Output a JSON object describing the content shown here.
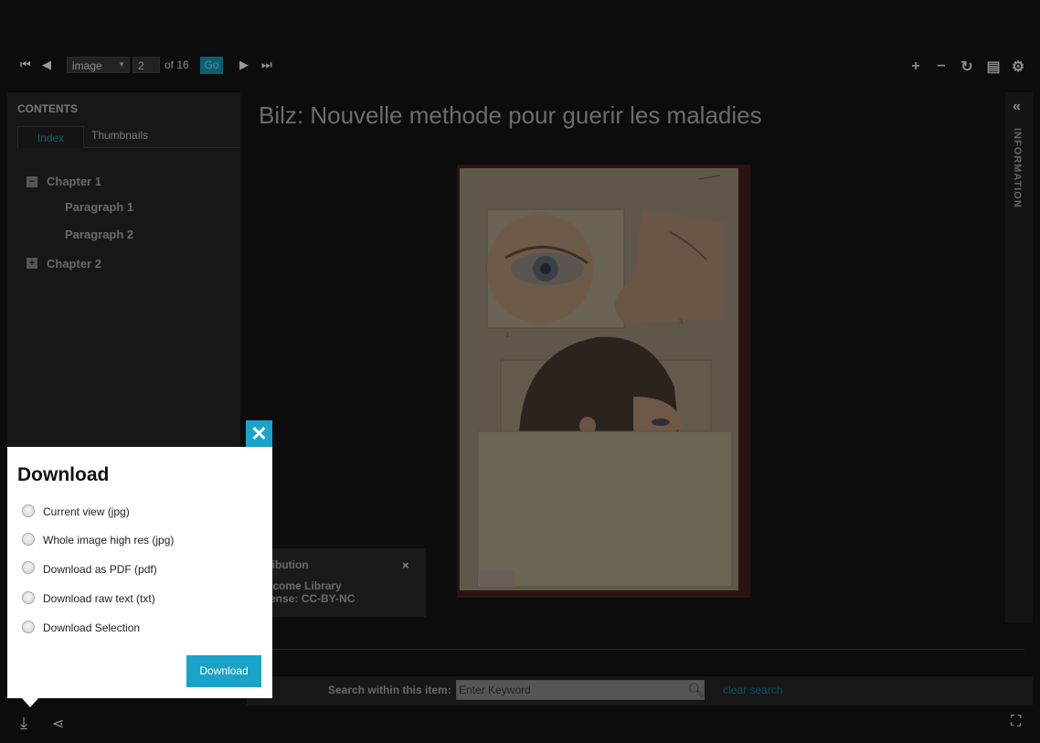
{
  "toolbar": {
    "image_select": "image",
    "page_value": "2",
    "page_of": "of 16",
    "go_label": "Go"
  },
  "left_panel": {
    "title": "CONTENTS",
    "tabs": [
      {
        "label": "Index",
        "active": true
      },
      {
        "label": "Thumbnails",
        "active": false
      }
    ],
    "tree": [
      {
        "label": "Chapter 1",
        "expanded": true,
        "toggle": "−"
      },
      {
        "label": "Paragraph 1",
        "child": true
      },
      {
        "label": "Paragraph 2",
        "child": true
      },
      {
        "label": "Chapter 2",
        "expanded": false,
        "toggle": "+"
      }
    ]
  },
  "main": {
    "title": "Bilz: Nouvelle methode pour guerir les maladies"
  },
  "attribution": {
    "title": "ttribution",
    "line1": "ellcome Library",
    "line2": "icense: CC-BY-NC",
    "close": "×"
  },
  "right_panel": {
    "label": "INFORMATION",
    "collapse": "«"
  },
  "search": {
    "label": "Search within this item:",
    "placeholder": "Enter Keyword",
    "clear": "clear search"
  },
  "download": {
    "title": "Download",
    "options": [
      "Current view (jpg)",
      "Whole image high res (jpg)",
      "Download as PDF (pdf)",
      "Download raw text (txt)",
      "Download Selection"
    ],
    "button": "Download",
    "close": "✕"
  },
  "colors": {
    "accent": "#1aa3c8",
    "background": "#0c0c0c"
  }
}
